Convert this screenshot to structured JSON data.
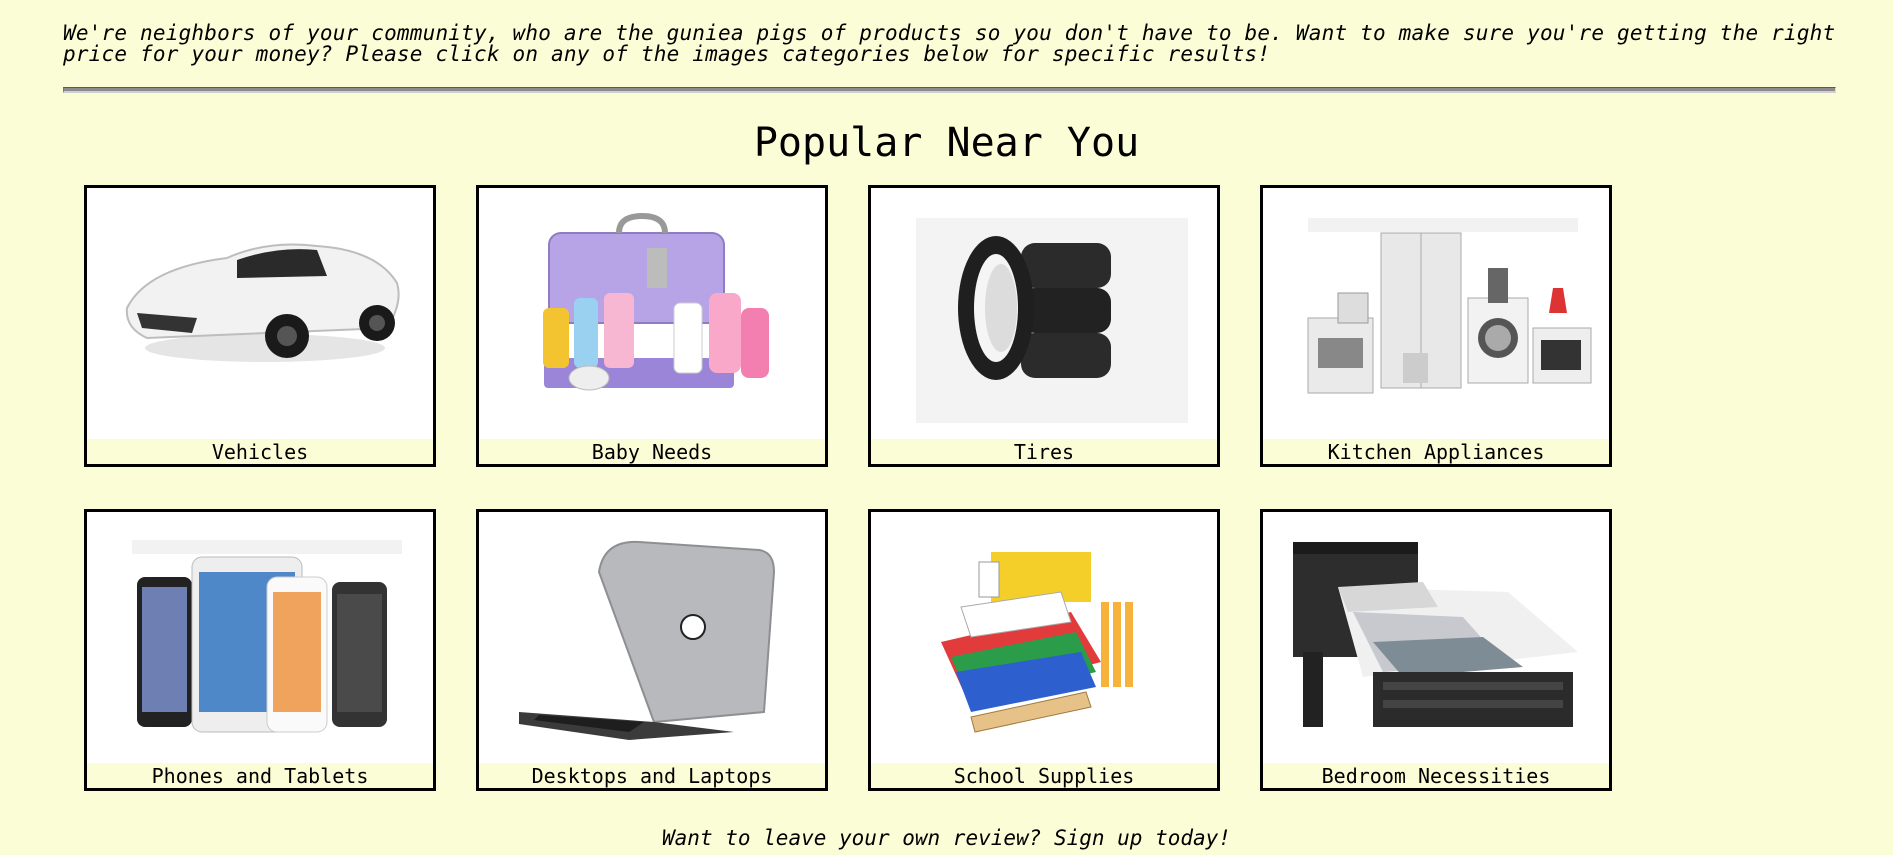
{
  "intro_text": "We're neighbors of your community, who are the guniea pigs of products so you don't have to be. Want to make sure you're getting the right price for your money? Please click on any of the images categories below for specific results!",
  "heading": "Popular Near You",
  "categories": [
    {
      "label": "Vehicles",
      "icon": "car-image"
    },
    {
      "label": "Baby Needs",
      "icon": "baby-kit-image"
    },
    {
      "label": "Tires",
      "icon": "tires-image"
    },
    {
      "label": "Kitchen Appliances",
      "icon": "appliances-image"
    },
    {
      "label": "Phones and Tablets",
      "icon": "phones-image"
    },
    {
      "label": "Desktops and Laptops",
      "icon": "laptop-image"
    },
    {
      "label": "School Supplies",
      "icon": "school-supplies-image"
    },
    {
      "label": "Bedroom Necessities",
      "icon": "bed-image"
    }
  ],
  "footer_text": "Want to leave your own review? Sign up today!",
  "colors": {
    "background": "#fafdd5",
    "border": "#000000",
    "divider": "#8c8c8c"
  }
}
